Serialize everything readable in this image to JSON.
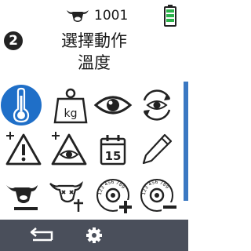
{
  "status": {
    "animal_count": "1001",
    "battery_level": 0.9,
    "battery_color": "#2bb34a",
    "icons": [
      "cow-icon",
      "battery-icon"
    ]
  },
  "header": {
    "step": "2",
    "title": "選擇動作",
    "subtitle": "溫度"
  },
  "grid": {
    "items": [
      {
        "name": "thermometer-icon",
        "selected": true
      },
      {
        "name": "weight-icon",
        "label": "kg"
      },
      {
        "name": "eye-icon"
      },
      {
        "name": "eye-refresh-icon"
      },
      {
        "name": "warning-plus-icon"
      },
      {
        "name": "eye-warning-plus-icon"
      },
      {
        "name": "calendar-icon",
        "label": "15"
      },
      {
        "name": "pencil-icon"
      },
      {
        "name": "cow-remove-icon"
      },
      {
        "name": "cow-dead-icon"
      },
      {
        "name": "tag-add-icon",
        "label": "123 456 789"
      },
      {
        "name": "tag-remove-icon",
        "label": "123 456 789"
      }
    ],
    "accent": "#1f6fc8"
  },
  "bottom_bar": {
    "icons": [
      "back-icon",
      "gear-icon"
    ],
    "background": "#4a4f5b"
  }
}
